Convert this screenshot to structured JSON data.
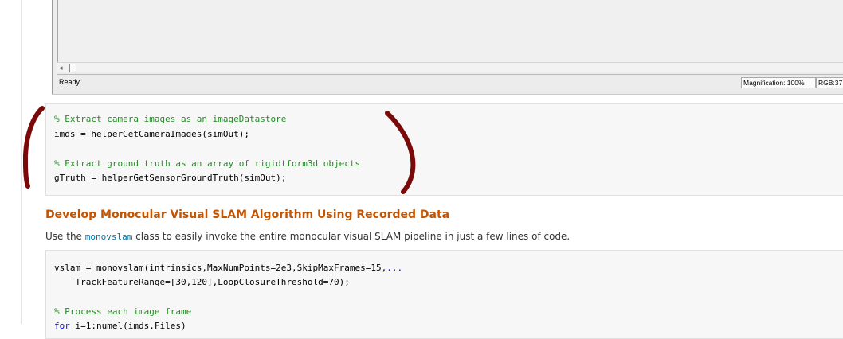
{
  "figure_window": {
    "status_text": "Ready",
    "magnification": "Magnification: 100%",
    "rgb": "RGB:37"
  },
  "code_block_1": {
    "line1": "% Extract camera images as an imageDatastore",
    "line2": "imds = helperGetCameraImages(simOut);",
    "line3": "% Extract ground truth as an array of rigidtform3d objects",
    "line4": "gTruth = helperGetSensorGroundTruth(simOut);"
  },
  "section": {
    "heading": "Develop Monocular Visual SLAM Algorithm Using Recorded Data",
    "intro_before": "Use the ",
    "intro_link": "monovslam",
    "intro_after": " class to easily invoke the entire monocular visual SLAM pipeline in just a few lines of code."
  },
  "code_block_2": {
    "line1": "vslam = monovslam(intrinsics,MaxNumPoints=2e3,SkipMaxFrames=15,",
    "line1_cont": "...",
    "line2": "    TrackFeatureRange=[30,120],LoopClosureThreshold=70);",
    "line3": "% Process each image frame",
    "line4_kw": "for",
    "line4_rest": " i=1:numel(imds.Files)"
  },
  "colors": {
    "heading": "#c45400",
    "comment": "#228b22",
    "link": "#0076a8",
    "ink": "#7a0a0a"
  }
}
